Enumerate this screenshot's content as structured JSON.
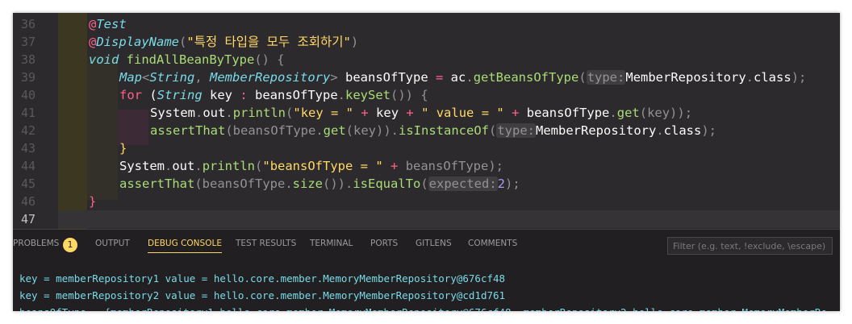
{
  "editor": {
    "line_numbers": [
      "36",
      "37",
      "38",
      "39",
      "40",
      "41",
      "42",
      "43",
      "44",
      "45",
      "46",
      "47"
    ],
    "active_line": "47",
    "lines": [
      [
        {
          "t": "@",
          "c": "at"
        },
        {
          "t": "Test",
          "c": "ann"
        }
      ],
      [
        {
          "t": "@",
          "c": "at"
        },
        {
          "t": "DisplayName",
          "c": "ann"
        },
        {
          "t": "(",
          "c": "pu"
        },
        {
          "t": "\"특정 타입을 모두 조회하기\"",
          "c": "str"
        },
        {
          "t": ")",
          "c": "pu"
        }
      ],
      [
        {
          "t": "void",
          "c": "ty"
        },
        {
          "t": " "
        },
        {
          "t": "findAllBeanByType",
          "c": "fn"
        },
        {
          "t": "() {",
          "c": "pu"
        }
      ],
      [
        {
          "t": "Map",
          "c": "ty"
        },
        {
          "t": "<",
          "c": "pu"
        },
        {
          "t": "String",
          "c": "ty"
        },
        {
          "t": ", ",
          "c": "pu"
        },
        {
          "t": "MemberRepository",
          "c": "ty"
        },
        {
          "t": ">",
          "c": "pu"
        },
        {
          "t": " beansOfType "
        },
        {
          "t": "=",
          "c": "kw"
        },
        {
          "t": " ac"
        },
        {
          "t": ".",
          "c": "pu"
        },
        {
          "t": "getBeansOfType",
          "c": "fn"
        },
        {
          "t": "(",
          "c": "pu"
        },
        {
          "t": "type:",
          "c": "hint"
        },
        {
          "t": "MemberRepository"
        },
        {
          "t": ".",
          "c": "pu"
        },
        {
          "t": "class"
        },
        {
          "t": ");",
          "c": "pu"
        }
      ],
      [
        {
          "t": "for",
          "c": "kw"
        },
        {
          "t": " ("
        },
        {
          "t": "String",
          "c": "ty"
        },
        {
          "t": " key "
        },
        {
          "t": ":",
          "c": "kw"
        },
        {
          "t": " beansOfType"
        },
        {
          "t": ".",
          "c": "pu"
        },
        {
          "t": "keySet",
          "c": "fn"
        },
        {
          "t": "()) {",
          "c": "pu"
        }
      ],
      [
        {
          "t": "System"
        },
        {
          "t": ".",
          "c": "pu"
        },
        {
          "t": "out"
        },
        {
          "t": ".",
          "c": "pu"
        },
        {
          "t": "println",
          "c": "fn"
        },
        {
          "t": "(",
          "c": "pu"
        },
        {
          "t": "\"key = \"",
          "c": "str"
        },
        {
          "t": " "
        },
        {
          "t": "+",
          "c": "kw"
        },
        {
          "t": " key "
        },
        {
          "t": "+",
          "c": "kw"
        },
        {
          "t": " "
        },
        {
          "t": "\" value = \"",
          "c": "str"
        },
        {
          "t": " "
        },
        {
          "t": "+",
          "c": "kw"
        },
        {
          "t": " beansOfType"
        },
        {
          "t": ".",
          "c": "pu"
        },
        {
          "t": "get",
          "c": "fn"
        },
        {
          "t": "(key));",
          "c": "pu"
        }
      ],
      [
        {
          "t": "assertThat",
          "c": "fn"
        },
        {
          "t": "(beansOfType",
          "c": "pu"
        },
        {
          "t": ".",
          "c": "pu"
        },
        {
          "t": "get",
          "c": "fn"
        },
        {
          "t": "(key))",
          "c": "pu"
        },
        {
          "t": ".",
          "c": "pu"
        },
        {
          "t": "isInstanceOf",
          "c": "fn"
        },
        {
          "t": "(",
          "c": "pu"
        },
        {
          "t": "type:",
          "c": "hint"
        },
        {
          "t": "MemberRepository"
        },
        {
          "t": ".",
          "c": "pu"
        },
        {
          "t": "class"
        },
        {
          "t": ");",
          "c": "pu"
        }
      ],
      [
        {
          "t": "}",
          "c": "str"
        }
      ],
      [
        {
          "t": "System"
        },
        {
          "t": ".",
          "c": "pu"
        },
        {
          "t": "out"
        },
        {
          "t": ".",
          "c": "pu"
        },
        {
          "t": "println",
          "c": "fn"
        },
        {
          "t": "(",
          "c": "pu"
        },
        {
          "t": "\"beansOfType = \"",
          "c": "str"
        },
        {
          "t": " "
        },
        {
          "t": "+",
          "c": "kw"
        },
        {
          "t": " beansOfType);",
          "c": "pu"
        }
      ],
      [
        {
          "t": "assertThat",
          "c": "fn"
        },
        {
          "t": "(beansOfType",
          "c": "pu"
        },
        {
          "t": ".",
          "c": "pu"
        },
        {
          "t": "size",
          "c": "fn"
        },
        {
          "t": "())",
          "c": "pu"
        },
        {
          "t": ".",
          "c": "pu"
        },
        {
          "t": "isEqualTo",
          "c": "fn"
        },
        {
          "t": "(",
          "c": "pu"
        },
        {
          "t": "expected:",
          "c": "hint"
        },
        {
          "t": "2",
          "c": "num"
        },
        {
          "t": ");",
          "c": "pu"
        }
      ],
      [
        {
          "t": "}",
          "c": "kw"
        }
      ],
      []
    ]
  },
  "panel": {
    "tabs": {
      "problems": "PROBLEMS",
      "output": "OUTPUT",
      "debug_console": "DEBUG CONSOLE",
      "test_results": "TEST RESULTS",
      "terminal": "TERMINAL",
      "ports": "PORTS",
      "gitlens": "GITLENS",
      "comments": "COMMENTS"
    },
    "problems_count": "1",
    "active_tab": "DEBUG CONSOLE",
    "filter_placeholder": "Filter (e.g. text, !exclude, \\escape)",
    "output_lines": [
      "key = memberRepository1 value = hello.core.member.MemoryMemberRepository@676cf48",
      "key = memberRepository2 value = hello.core.member.MemoryMemberRepository@cd1d761",
      "beansOfType = {memberRepository1=hello.core.member.MemoryMemberRepository@676cf48, memberRepository2=hello.core.member.MemoryMemberRe"
    ]
  },
  "colors": {
    "accent": "#ffd866",
    "keyword": "#ff6188",
    "type": "#78dce8",
    "function": "#a9dc76",
    "string": "#ffd866",
    "number": "#ab9df2",
    "background": "#2d2a2e"
  }
}
